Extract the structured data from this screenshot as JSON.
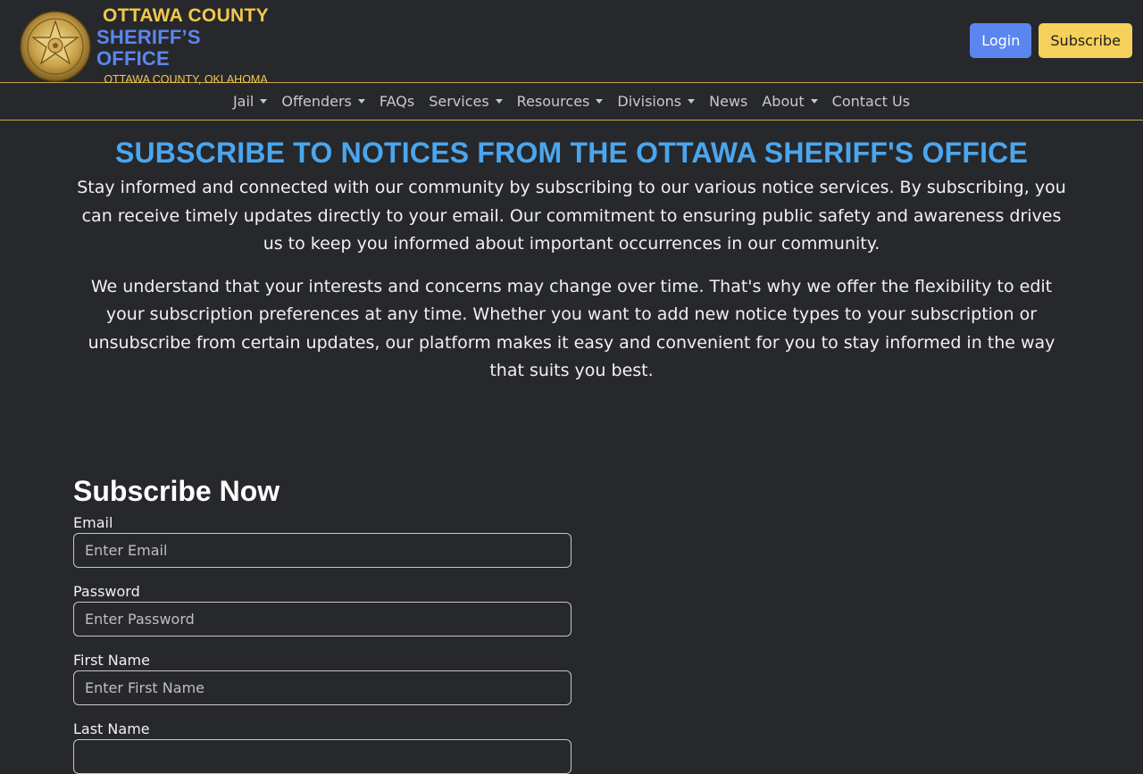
{
  "header": {
    "logo_line1": "OTTAWA COUNTY",
    "logo_line2": "SHERIFF’S OFFICE",
    "logo_line3": "OTTAWA COUNTY, OKLAHOMA",
    "login_label": "Login",
    "subscribe_label": "Subscribe"
  },
  "nav": {
    "items": [
      {
        "label": "Jail",
        "dropdown": true
      },
      {
        "label": "Offenders",
        "dropdown": true
      },
      {
        "label": "FAQs",
        "dropdown": false
      },
      {
        "label": "Services",
        "dropdown": true
      },
      {
        "label": "Resources",
        "dropdown": true
      },
      {
        "label": "Divisions",
        "dropdown": true
      },
      {
        "label": "News",
        "dropdown": false
      },
      {
        "label": "About",
        "dropdown": true
      },
      {
        "label": "Contact Us",
        "dropdown": false
      }
    ]
  },
  "main": {
    "title": "SUBSCRIBE TO NOTICES FROM THE OTTAWA SHERIFF'S OFFICE",
    "paragraph1": "Stay informed and connected with our community by subscribing to our various notice services. By subscribing, you can receive timely updates directly to your email. Our commitment to ensuring public safety and awareness drives us to keep you informed about important occurrences in our community.",
    "paragraph2": "We understand that your interests and concerns may change over time. That's why we offer the flexibility to edit your subscription preferences at any time. Whether you want to add new notice types to your subscription or unsubscribe from certain updates, our platform makes it easy and convenient for you to stay informed in the way that suits you best."
  },
  "form": {
    "title": "Subscribe Now",
    "email": {
      "label": "Email",
      "placeholder": "Enter Email"
    },
    "password": {
      "label": "Password",
      "placeholder": "Enter Password"
    },
    "first_name": {
      "label": "First Name",
      "placeholder": "Enter First Name"
    },
    "last_name": {
      "label": "Last Name",
      "placeholder": ""
    }
  },
  "colors": {
    "background": "#27282b",
    "accent_gold": "#f2c84b",
    "accent_blue": "#5b86f0",
    "title_blue": "#4aa6ee",
    "subscribe_button": "#f5d05a"
  },
  "icons": {
    "badge": "sheriff-star-badge-icon",
    "dropdown": "caret-down-icon"
  }
}
